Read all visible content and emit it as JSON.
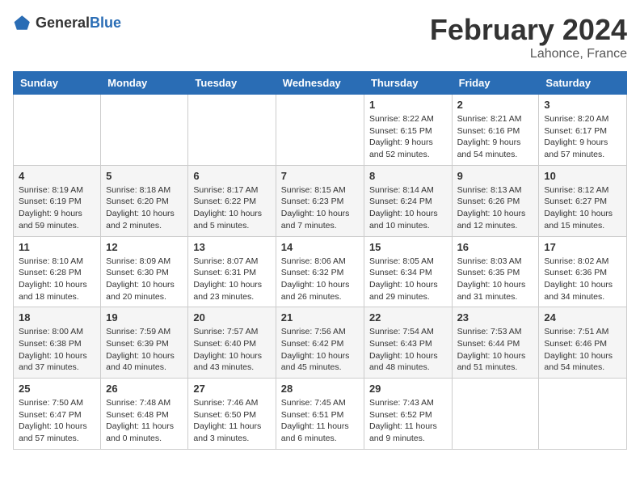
{
  "header": {
    "logo_general": "General",
    "logo_blue": "Blue",
    "month_title": "February 2024",
    "location": "Lahonce, France"
  },
  "weekdays": [
    "Sunday",
    "Monday",
    "Tuesday",
    "Wednesday",
    "Thursday",
    "Friday",
    "Saturday"
  ],
  "weeks": [
    [
      {
        "day": "",
        "info": ""
      },
      {
        "day": "",
        "info": ""
      },
      {
        "day": "",
        "info": ""
      },
      {
        "day": "",
        "info": ""
      },
      {
        "day": "1",
        "info": "Sunrise: 8:22 AM\nSunset: 6:15 PM\nDaylight: 9 hours\nand 52 minutes."
      },
      {
        "day": "2",
        "info": "Sunrise: 8:21 AM\nSunset: 6:16 PM\nDaylight: 9 hours\nand 54 minutes."
      },
      {
        "day": "3",
        "info": "Sunrise: 8:20 AM\nSunset: 6:17 PM\nDaylight: 9 hours\nand 57 minutes."
      }
    ],
    [
      {
        "day": "4",
        "info": "Sunrise: 8:19 AM\nSunset: 6:19 PM\nDaylight: 9 hours\nand 59 minutes."
      },
      {
        "day": "5",
        "info": "Sunrise: 8:18 AM\nSunset: 6:20 PM\nDaylight: 10 hours\nand 2 minutes."
      },
      {
        "day": "6",
        "info": "Sunrise: 8:17 AM\nSunset: 6:22 PM\nDaylight: 10 hours\nand 5 minutes."
      },
      {
        "day": "7",
        "info": "Sunrise: 8:15 AM\nSunset: 6:23 PM\nDaylight: 10 hours\nand 7 minutes."
      },
      {
        "day": "8",
        "info": "Sunrise: 8:14 AM\nSunset: 6:24 PM\nDaylight: 10 hours\nand 10 minutes."
      },
      {
        "day": "9",
        "info": "Sunrise: 8:13 AM\nSunset: 6:26 PM\nDaylight: 10 hours\nand 12 minutes."
      },
      {
        "day": "10",
        "info": "Sunrise: 8:12 AM\nSunset: 6:27 PM\nDaylight: 10 hours\nand 15 minutes."
      }
    ],
    [
      {
        "day": "11",
        "info": "Sunrise: 8:10 AM\nSunset: 6:28 PM\nDaylight: 10 hours\nand 18 minutes."
      },
      {
        "day": "12",
        "info": "Sunrise: 8:09 AM\nSunset: 6:30 PM\nDaylight: 10 hours\nand 20 minutes."
      },
      {
        "day": "13",
        "info": "Sunrise: 8:07 AM\nSunset: 6:31 PM\nDaylight: 10 hours\nand 23 minutes."
      },
      {
        "day": "14",
        "info": "Sunrise: 8:06 AM\nSunset: 6:32 PM\nDaylight: 10 hours\nand 26 minutes."
      },
      {
        "day": "15",
        "info": "Sunrise: 8:05 AM\nSunset: 6:34 PM\nDaylight: 10 hours\nand 29 minutes."
      },
      {
        "day": "16",
        "info": "Sunrise: 8:03 AM\nSunset: 6:35 PM\nDaylight: 10 hours\nand 31 minutes."
      },
      {
        "day": "17",
        "info": "Sunrise: 8:02 AM\nSunset: 6:36 PM\nDaylight: 10 hours\nand 34 minutes."
      }
    ],
    [
      {
        "day": "18",
        "info": "Sunrise: 8:00 AM\nSunset: 6:38 PM\nDaylight: 10 hours\nand 37 minutes."
      },
      {
        "day": "19",
        "info": "Sunrise: 7:59 AM\nSunset: 6:39 PM\nDaylight: 10 hours\nand 40 minutes."
      },
      {
        "day": "20",
        "info": "Sunrise: 7:57 AM\nSunset: 6:40 PM\nDaylight: 10 hours\nand 43 minutes."
      },
      {
        "day": "21",
        "info": "Sunrise: 7:56 AM\nSunset: 6:42 PM\nDaylight: 10 hours\nand 45 minutes."
      },
      {
        "day": "22",
        "info": "Sunrise: 7:54 AM\nSunset: 6:43 PM\nDaylight: 10 hours\nand 48 minutes."
      },
      {
        "day": "23",
        "info": "Sunrise: 7:53 AM\nSunset: 6:44 PM\nDaylight: 10 hours\nand 51 minutes."
      },
      {
        "day": "24",
        "info": "Sunrise: 7:51 AM\nSunset: 6:46 PM\nDaylight: 10 hours\nand 54 minutes."
      }
    ],
    [
      {
        "day": "25",
        "info": "Sunrise: 7:50 AM\nSunset: 6:47 PM\nDaylight: 10 hours\nand 57 minutes."
      },
      {
        "day": "26",
        "info": "Sunrise: 7:48 AM\nSunset: 6:48 PM\nDaylight: 11 hours\nand 0 minutes."
      },
      {
        "day": "27",
        "info": "Sunrise: 7:46 AM\nSunset: 6:50 PM\nDaylight: 11 hours\nand 3 minutes."
      },
      {
        "day": "28",
        "info": "Sunrise: 7:45 AM\nSunset: 6:51 PM\nDaylight: 11 hours\nand 6 minutes."
      },
      {
        "day": "29",
        "info": "Sunrise: 7:43 AM\nSunset: 6:52 PM\nDaylight: 11 hours\nand 9 minutes."
      },
      {
        "day": "",
        "info": ""
      },
      {
        "day": "",
        "info": ""
      }
    ]
  ]
}
